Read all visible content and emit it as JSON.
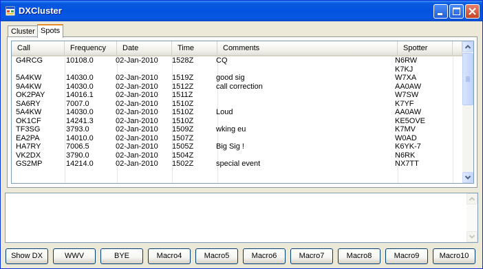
{
  "window": {
    "title": "DXCluster"
  },
  "tabs": [
    {
      "label": "Cluster"
    },
    {
      "label": "Spots"
    }
  ],
  "spots": {
    "columns": [
      "Call",
      "Frequency",
      "Date",
      "Time",
      "Comments",
      "Spotter"
    ],
    "rows": [
      [
        "G4RCG",
        "10108.0",
        "02-Jan-2010",
        "1528Z",
        "CQ",
        "N6RW"
      ],
      [
        "",
        "",
        "",
        "",
        "",
        "K7KJ"
      ],
      [
        "5A4KW",
        "14030.0",
        "02-Jan-2010",
        "1519Z",
        "good sig",
        "W7XA"
      ],
      [
        "9A4KW",
        "14030.0",
        "02-Jan-2010",
        "1512Z",
        "call correction",
        "AA0AW"
      ],
      [
        "OK2PAY",
        "14016.1",
        "02-Jan-2010",
        "1511Z",
        "",
        "W7SW"
      ],
      [
        "SA6RY",
        "7007.0",
        "02-Jan-2010",
        "1510Z",
        "",
        "K7YF"
      ],
      [
        "5A4KW",
        "14030.0",
        "02-Jan-2010",
        "1510Z",
        "Loud",
        "AA0AW"
      ],
      [
        "OK1CF",
        "14241.3",
        "02-Jan-2010",
        "1510Z",
        "",
        "KE5OVE"
      ],
      [
        "TF3SG",
        "3793.0",
        "02-Jan-2010",
        "1509Z",
        "wking eu",
        "K7MV"
      ],
      [
        "EA2PA",
        "14010.0",
        "02-Jan-2010",
        "1507Z",
        "",
        "W0AD"
      ],
      [
        "HA7RY",
        "7006.5",
        "02-Jan-2010",
        "1505Z",
        "Big Sig !",
        "K6YK-7"
      ],
      [
        "VK2DX",
        "3790.0",
        "02-Jan-2010",
        "1504Z",
        "",
        "N6RK"
      ],
      [
        "GS2MP",
        "14214.0",
        "02-Jan-2010",
        "1502Z",
        "special event",
        "NX7TT"
      ]
    ]
  },
  "buttons": [
    "Show DX",
    "WWV",
    "BYE",
    "Macro4",
    "Macro5",
    "Macro6",
    "Macro7",
    "Macro8",
    "Macro9",
    "Macro10"
  ]
}
